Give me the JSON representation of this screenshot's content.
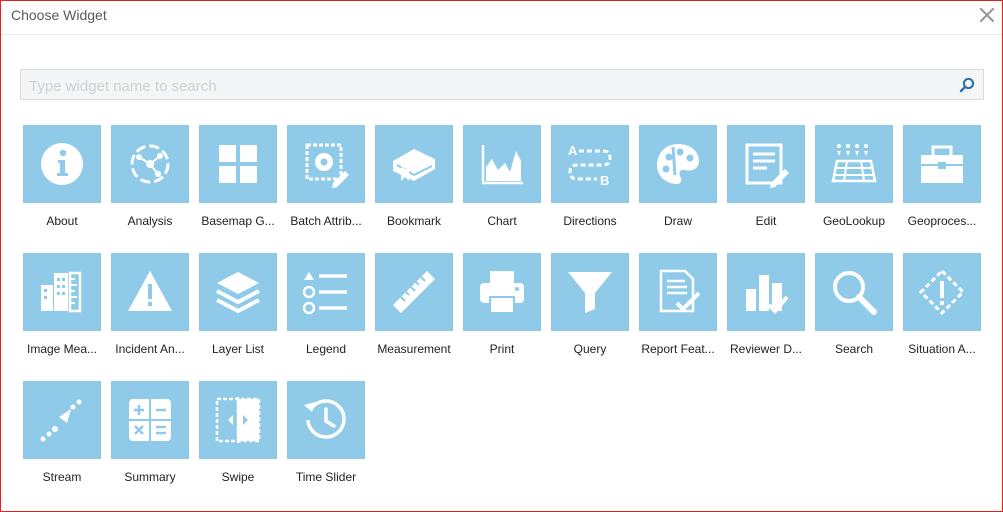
{
  "dialog": {
    "title": "Choose Widget"
  },
  "search": {
    "placeholder": "Type widget name to search",
    "value": ""
  },
  "colors": {
    "tile": "#8fcbe9",
    "border": "#e0211d"
  },
  "widgets": [
    {
      "label": "About",
      "icon": "info-icon"
    },
    {
      "label": "Analysis",
      "icon": "analysis-icon"
    },
    {
      "label": "Basemap G...",
      "icon": "basemap-gallery-icon"
    },
    {
      "label": "Batch Attrib...",
      "icon": "batch-attribute-editor-icon"
    },
    {
      "label": "Bookmark",
      "icon": "bookmark-icon"
    },
    {
      "label": "Chart",
      "icon": "chart-icon"
    },
    {
      "label": "Directions",
      "icon": "directions-icon"
    },
    {
      "label": "Draw",
      "icon": "palette-icon"
    },
    {
      "label": "Edit",
      "icon": "edit-icon"
    },
    {
      "label": "GeoLookup",
      "icon": "geolookup-icon"
    },
    {
      "label": "Geoproces...",
      "icon": "toolbox-icon"
    },
    {
      "label": "Image Mea...",
      "icon": "image-measurement-icon"
    },
    {
      "label": "Incident An...",
      "icon": "warning-icon"
    },
    {
      "label": "Layer List",
      "icon": "layers-icon"
    },
    {
      "label": "Legend",
      "icon": "legend-icon"
    },
    {
      "label": "Measurement",
      "icon": "ruler-icon"
    },
    {
      "label": "Print",
      "icon": "printer-icon"
    },
    {
      "label": "Query",
      "icon": "funnel-icon"
    },
    {
      "label": "Report Feat...",
      "icon": "report-feature-icon"
    },
    {
      "label": "Reviewer D...",
      "icon": "reviewer-dashboard-icon"
    },
    {
      "label": "Search",
      "icon": "magnifier-icon"
    },
    {
      "label": "Situation A...",
      "icon": "situation-awareness-icon"
    },
    {
      "label": "Stream",
      "icon": "stream-icon"
    },
    {
      "label": "Summary",
      "icon": "calculator-icon"
    },
    {
      "label": "Swipe",
      "icon": "swipe-icon"
    },
    {
      "label": "Time Slider",
      "icon": "clock-icon"
    }
  ]
}
